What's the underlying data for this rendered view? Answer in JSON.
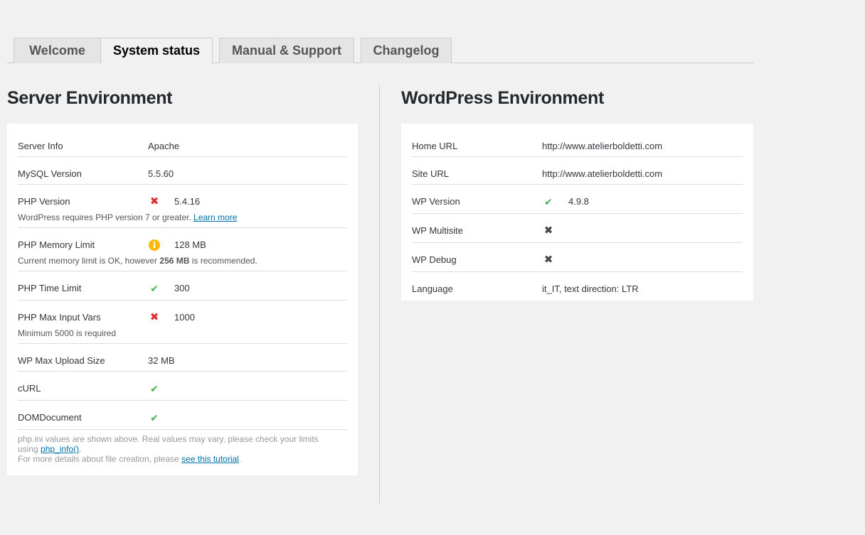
{
  "tabs": [
    {
      "label": "Welcome",
      "active": false
    },
    {
      "label": "System status",
      "active": true
    },
    {
      "label": "Manual & Support",
      "active": false
    },
    {
      "label": "Changelog",
      "active": false
    }
  ],
  "server": {
    "title": "Server Environment",
    "rows": {
      "server_info": {
        "label": "Server Info",
        "value": "Apache"
      },
      "mysql": {
        "label": "MySQL Version",
        "value": "5.5.60"
      },
      "php_version": {
        "label": "PHP Version",
        "status": "error",
        "value": "5.4.16",
        "note": "WordPress requires PHP version 7 or greater.",
        "note_link": "Learn more"
      },
      "memory": {
        "label": "PHP Memory Limit",
        "status": "warning",
        "value": "128 MB",
        "note_prefix": "Current memory limit is OK, however",
        "note_bold": "256 MB",
        "note_suffix": "is recommended."
      },
      "time_limit": {
        "label": "PHP Time Limit",
        "status": "ok",
        "value": "300"
      },
      "max_input": {
        "label": "PHP Max Input Vars",
        "status": "error",
        "value": "1000",
        "note": "Minimum 5000 is required"
      },
      "upload": {
        "label": "WP Max Upload Size",
        "value": "32 MB"
      },
      "curl": {
        "label": "cURL",
        "status": "ok"
      },
      "domdocument": {
        "label": "DOMDocument",
        "status": "ok"
      }
    },
    "footer": {
      "line1": "php.ini values are shown above. Real values may vary, please check your limits",
      "line2_prefix": "using",
      "line2_link": "php_info()",
      "line2_suffix": ".",
      "line3_prefix": "For more details about file creation, please",
      "line3_link": "see this tutorial",
      "line3_suffix": "."
    }
  },
  "wordpress": {
    "title": "WordPress Environment",
    "rows": {
      "home_url": {
        "label": "Home URL",
        "value": "http://www.atelierboldetti.com"
      },
      "site_url": {
        "label": "Site URL",
        "value": "http://www.atelierboldetti.com"
      },
      "wp_version": {
        "label": "WP Version",
        "status": "ok",
        "value": "4.9.8"
      },
      "multisite": {
        "label": "WP Multisite",
        "status": "disabled"
      },
      "debug": {
        "label": "WP Debug",
        "status": "disabled"
      },
      "language": {
        "label": "Language",
        "value": "it_IT, text direction: LTR"
      }
    }
  },
  "colors": {
    "error": "#dc3232",
    "ok": "#46b450",
    "warning": "#ffb900",
    "link": "#0073aa"
  }
}
